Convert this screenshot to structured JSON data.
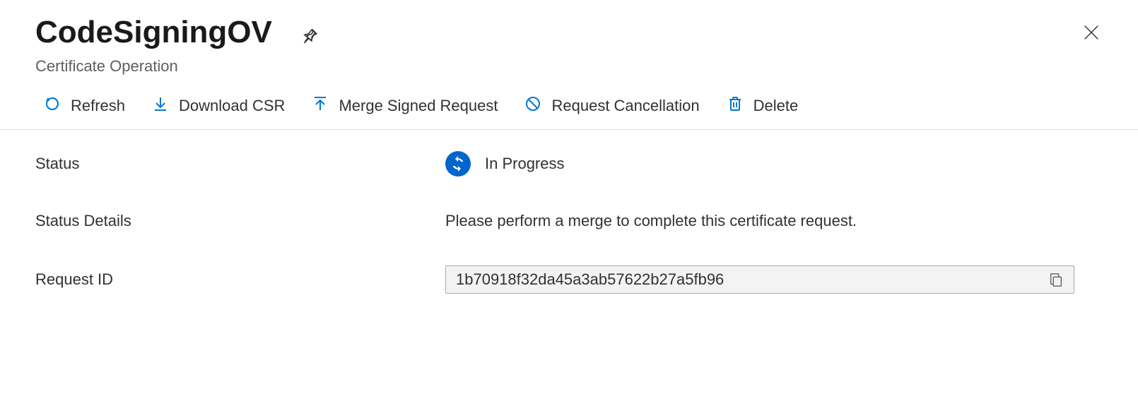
{
  "header": {
    "title": "CodeSigningOV",
    "subtitle": "Certificate Operation"
  },
  "toolbar": {
    "refresh": "Refresh",
    "download_csr": "Download CSR",
    "merge_signed": "Merge Signed Request",
    "request_cancellation": "Request Cancellation",
    "delete": "Delete"
  },
  "fields": {
    "status": {
      "label": "Status",
      "value": "In Progress"
    },
    "status_details": {
      "label": "Status Details",
      "value": "Please perform a merge to complete this certificate request."
    },
    "request_id": {
      "label": "Request ID",
      "value": "1b70918f32da45a3ab57622b27a5fb96"
    }
  },
  "colors": {
    "azure_blue": "#0078d4",
    "icon_blue": "#0066cc"
  }
}
